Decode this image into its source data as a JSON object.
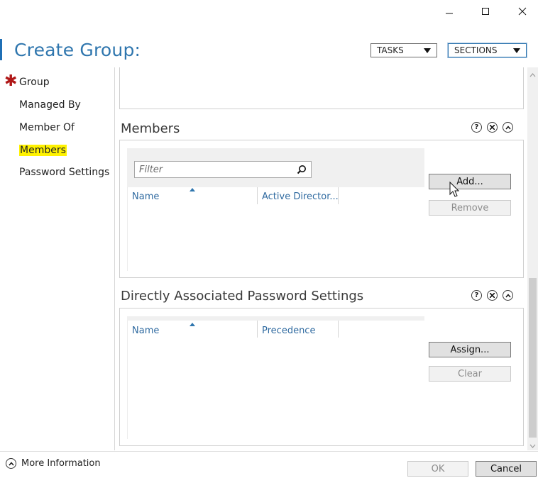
{
  "window": {
    "controls": [
      "minimize",
      "maximize",
      "close"
    ],
    "minimize_icon": "minimize-icon",
    "maximize_icon": "maximize-icon",
    "close_icon": "close-icon"
  },
  "header": {
    "title": "Create Group:",
    "tasks_label": "TASKS",
    "sections_label": "SECTIONS"
  },
  "nav": {
    "items": [
      {
        "label": "Group",
        "required": true
      },
      {
        "label": "Managed By"
      },
      {
        "label": "Member Of"
      },
      {
        "label": "Members",
        "highlighted": true
      },
      {
        "label": "Password Settings"
      }
    ],
    "required_color": "#b01818",
    "highlight_color": "#fff200"
  },
  "members": {
    "title": "Members",
    "filter_placeholder": "Filter",
    "columns": [
      "Name",
      "Active Director..."
    ],
    "add_label": "Add...",
    "remove_label": "Remove"
  },
  "password_settings": {
    "title": "Directly Associated Password Settings",
    "columns": [
      "Name",
      "Precedence"
    ],
    "assign_label": "Assign...",
    "clear_label": "Clear"
  },
  "section_controls": {
    "help": "?",
    "close": "✕",
    "collapse": "^"
  },
  "footer": {
    "more_info_label": "More Information",
    "ok_label": "OK",
    "cancel_label": "Cancel"
  },
  "colors": {
    "accent": "#2f76ae",
    "column_header": "#2f6aa0"
  }
}
